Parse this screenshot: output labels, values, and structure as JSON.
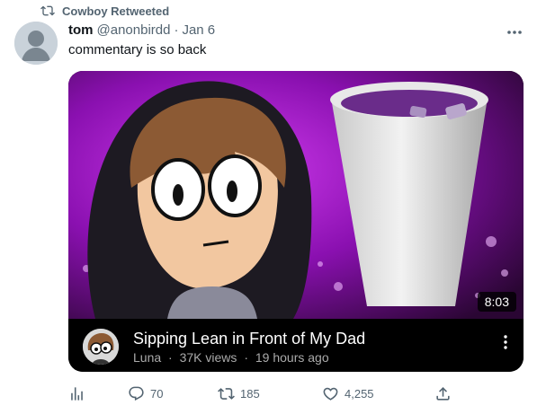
{
  "retweet": {
    "label": "Cowboy Retweeted"
  },
  "tweet": {
    "name": "tom",
    "handle": "@anonbirdd",
    "separator": "·",
    "date": "Jan 6",
    "text": "commentary is so back"
  },
  "video": {
    "duration": "8:03",
    "title": "Sipping Lean in Front of My Dad",
    "channel": "Luna",
    "views": "37K views",
    "age": "19 hours ago",
    "meta_separator": "·"
  },
  "actions": {
    "replies": "70",
    "retweets": "185",
    "likes": "4,255"
  },
  "colors": {
    "muted": "#536471",
    "purple": "#a012c8",
    "thumb_bg": "#2a0633"
  }
}
